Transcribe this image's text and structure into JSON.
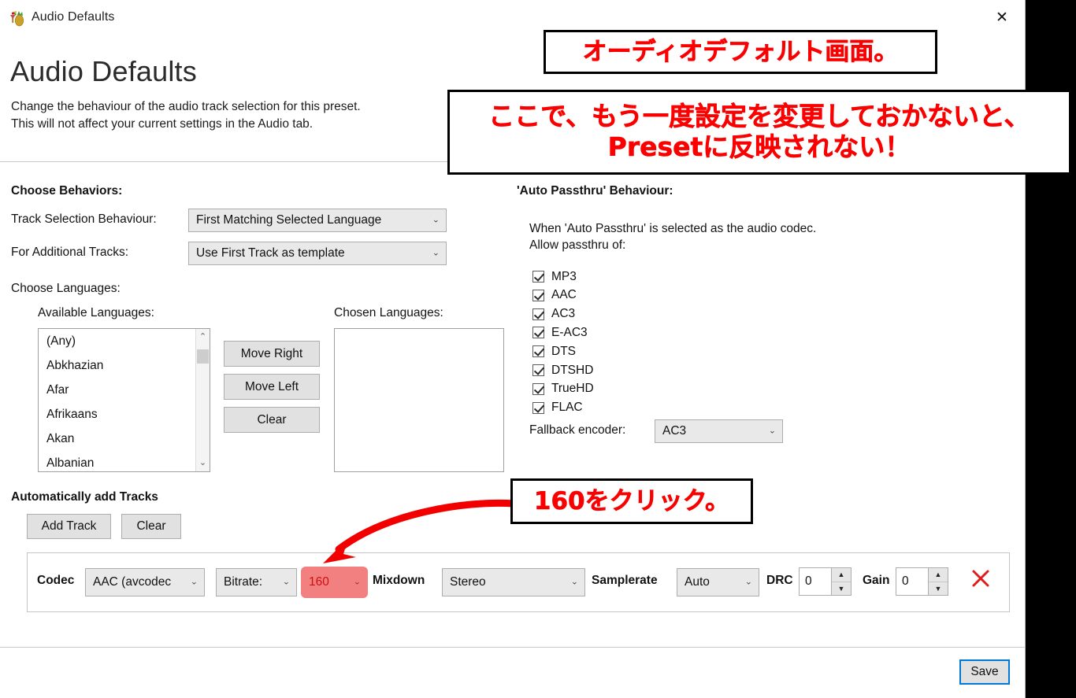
{
  "window": {
    "titlebar": {
      "icon": "handbrake-pineapple-icon",
      "title": "Audio Defaults",
      "close": "✕"
    },
    "header": {
      "title": "Audio Defaults",
      "description_line1": "Change the behaviour of the audio track selection for this preset.",
      "description_line2": "This will not affect your current settings in the Audio tab."
    },
    "behaviors": {
      "section_label": "Choose Behaviors:",
      "track_selection_label": "Track Selection Behaviour:",
      "track_selection_value": "First Matching Selected Language",
      "additional_tracks_label": "For Additional Tracks:",
      "additional_tracks_value": "Use First Track as template"
    },
    "languages": {
      "section_label": "Choose Languages:",
      "available_label": "Available Languages:",
      "chosen_label": "Chosen Languages:",
      "available_items": [
        "(Any)",
        "Abkhazian",
        "Afar",
        "Afrikaans",
        "Akan",
        "Albanian"
      ],
      "chosen_items": [],
      "move_right_label": "Move Right",
      "move_left_label": "Move Left",
      "clear_label": "Clear"
    },
    "passthru": {
      "section_label": "'Auto Passthru' Behaviour:",
      "info_line1": "When 'Auto Passthru' is selected as the audio codec.",
      "info_line2": "Allow passthru of:",
      "codecs": [
        {
          "label": "MP3",
          "checked": true
        },
        {
          "label": "AAC",
          "checked": true
        },
        {
          "label": "AC3",
          "checked": true
        },
        {
          "label": "E-AC3",
          "checked": true
        },
        {
          "label": "DTS",
          "checked": true
        },
        {
          "label": "DTSHD",
          "checked": true
        },
        {
          "label": "TrueHD",
          "checked": true
        },
        {
          "label": "FLAC",
          "checked": true
        }
      ],
      "fallback_label": "Fallback encoder:",
      "fallback_value": "AC3"
    },
    "auto_tracks": {
      "section_label": "Automatically add Tracks",
      "add_track_label": "Add Track",
      "clear_label": "Clear"
    },
    "track_row": {
      "codec_label": "Codec",
      "codec_value": "AAC (avcodec",
      "bitrate_label": "Bitrate:",
      "bitrate_value": "160",
      "mixdown_label": "Mixdown",
      "mixdown_value": "Stereo",
      "samplerate_label": "Samplerate",
      "samplerate_value": "Auto",
      "drc_label": "DRC",
      "drc_value": "0",
      "gain_label": "Gain",
      "gain_value": "0",
      "remove_icon": "remove-x-icon"
    },
    "footer": {
      "save_label": "Save"
    }
  },
  "annotations": {
    "callout1": "オーディオデフォルト画面。",
    "callout2_line1": "ここで、もう一度設定を変更しておかないと、",
    "callout2_line2": "Presetに反映されない！",
    "callout3": "160をクリック。",
    "arrow_icon": "curved-red-arrow-icon",
    "highlight_color": "#f28080",
    "annotation_color": "#fb0000"
  }
}
